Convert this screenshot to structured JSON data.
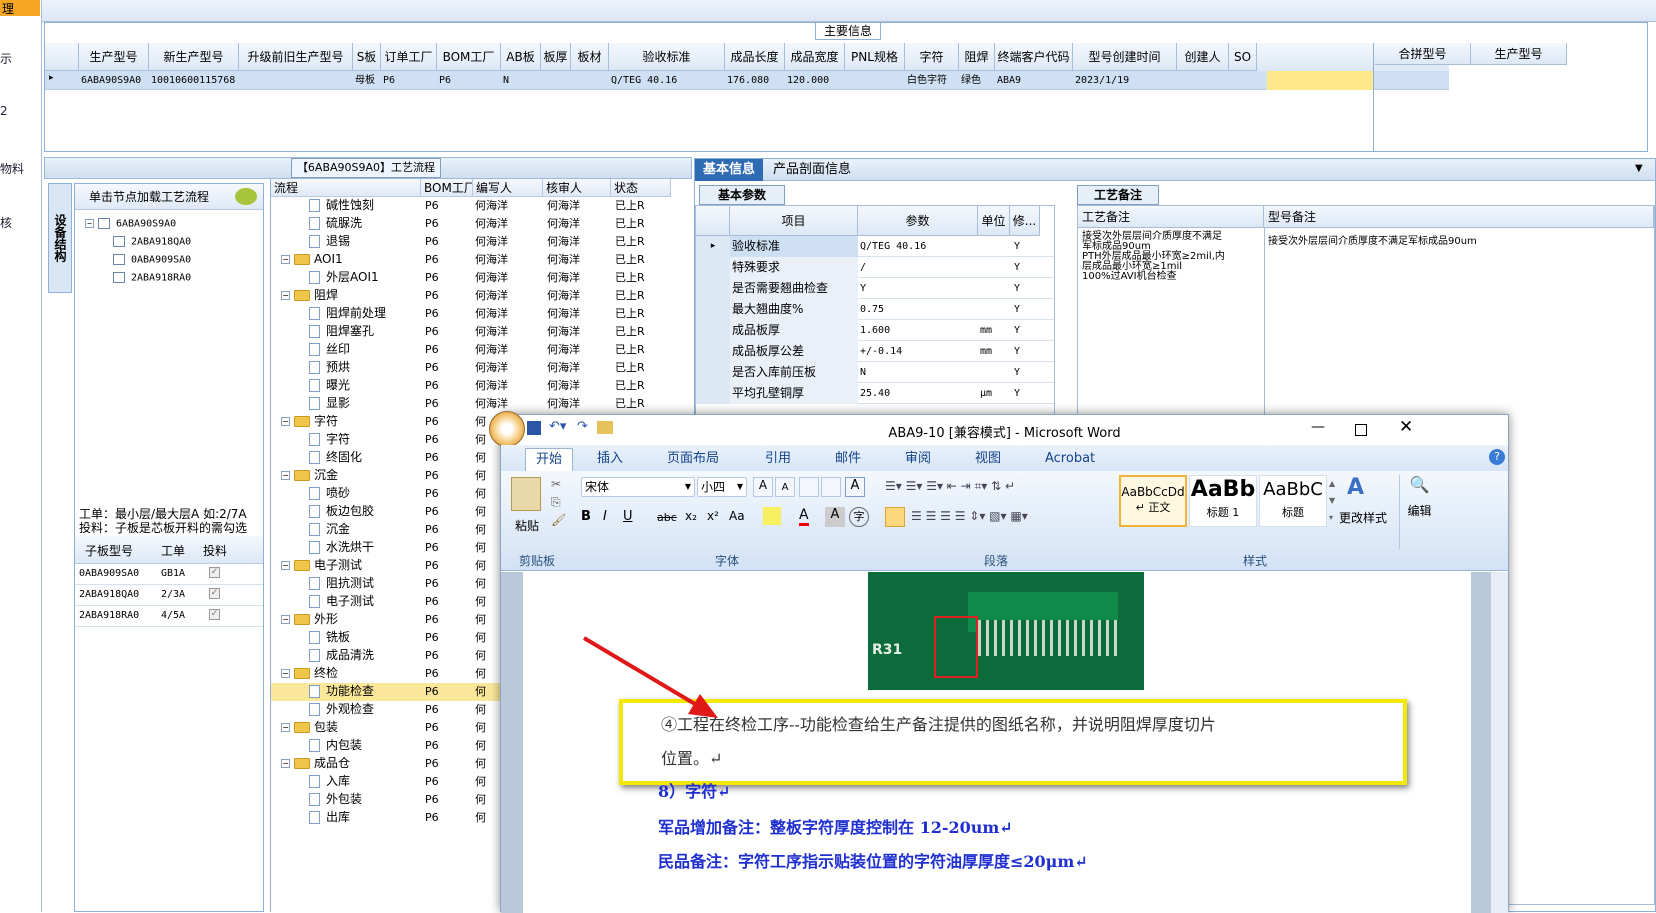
{
  "left_trim": {
    "labels": [
      "理",
      "示",
      "2",
      "物料",
      "核"
    ]
  },
  "main_info": {
    "legend": "主要信息",
    "headers": [
      "生产型号",
      "新生产型号",
      "升级前旧生产型号",
      "S板",
      "订单工厂",
      "BOM工厂",
      "AB板",
      "板厚",
      "板材",
      "验收标准",
      "成品长度",
      "成品宽度",
      "PNL规格",
      "字符",
      "阻焊",
      "终端客户代码",
      "型号创建时间",
      "创建人",
      "SO"
    ],
    "row": [
      "6ABA90S9A0",
      "10010600115768",
      "",
      "母板",
      "P6",
      "P6",
      "N",
      "",
      "",
      "Q/TEG 40.16",
      "176.080",
      "120.000",
      "",
      "白色字符",
      "绿色",
      "ABA9",
      "2023/1/19",
      "",
      ""
    ],
    "right_headers": [
      "合拼型号",
      "生产型号"
    ]
  },
  "flow": {
    "title": "【6ABA90S9A0】工艺流程",
    "lp_tab": "设备结构",
    "lp_header": "单击节点加载工艺流程",
    "tree": [
      "6ABA90S9A0",
      "2ABA918QA0",
      "0ABA909SA0",
      "2ABA918RA0"
    ],
    "note_lines": [
      "工单：最小层/最大层A 如:2/7A",
      "投料：子板是芯板开料的需勾选"
    ],
    "sub_headers": [
      "子板型号",
      "工单",
      "投料"
    ],
    "sub_rows": [
      [
        "0ABA909SA0",
        "GB1A"
      ],
      [
        "2ABA918QA0",
        "2/3A"
      ],
      [
        "2ABA918RA0",
        "4/5A"
      ]
    ],
    "headers": [
      "流程",
      "BOM工厂",
      "编写人",
      "核审人",
      "状态"
    ],
    "rows": [
      {
        "n": "碱性蚀刻",
        "t": "doc"
      },
      {
        "n": "硫脲洗",
        "t": "doc"
      },
      {
        "n": "退锡",
        "t": "doc"
      },
      {
        "n": "AOI1",
        "t": "folder"
      },
      {
        "n": "外层AOI1",
        "t": "doc"
      },
      {
        "n": "阻焊",
        "t": "folder"
      },
      {
        "n": "阻焊前处理",
        "t": "doc"
      },
      {
        "n": "阻焊塞孔",
        "t": "doc"
      },
      {
        "n": "丝印",
        "t": "doc"
      },
      {
        "n": "预烘",
        "t": "doc"
      },
      {
        "n": "曝光",
        "t": "doc"
      },
      {
        "n": "显影",
        "t": "doc"
      },
      {
        "n": "字符",
        "t": "folder"
      },
      {
        "n": "字符",
        "t": "doc"
      },
      {
        "n": "终固化",
        "t": "doc"
      },
      {
        "n": "沉金",
        "t": "folder"
      },
      {
        "n": "喷砂",
        "t": "doc"
      },
      {
        "n": "板边包胶",
        "t": "doc"
      },
      {
        "n": "沉金",
        "t": "doc"
      },
      {
        "n": "水洗烘干",
        "t": "doc"
      },
      {
        "n": "电子测试",
        "t": "folder"
      },
      {
        "n": "阻抗测试",
        "t": "doc"
      },
      {
        "n": "电子测试",
        "t": "doc"
      },
      {
        "n": "外形",
        "t": "folder"
      },
      {
        "n": "铣板",
        "t": "doc"
      },
      {
        "n": "成品清洗",
        "t": "doc"
      },
      {
        "n": "终检",
        "t": "folder"
      },
      {
        "n": "功能检查",
        "t": "doc"
      },
      {
        "n": "外观检查",
        "t": "doc"
      },
      {
        "n": "包装",
        "t": "folder"
      },
      {
        "n": "内包装",
        "t": "doc"
      },
      {
        "n": "成品仓",
        "t": "folder"
      },
      {
        "n": "入库",
        "t": "doc"
      },
      {
        "n": "外包装",
        "t": "doc"
      },
      {
        "n": "出库",
        "t": "doc"
      }
    ],
    "factory": "P6",
    "writer": "何海洋",
    "reviewer": "何海洋",
    "status": "已上R",
    "writer_short": "何"
  },
  "right": {
    "tabs": [
      "基本信息",
      "产品剖面信息"
    ],
    "sub_tab": "基本参数",
    "param_headers": [
      "项目",
      "参数",
      "单位",
      "修..."
    ],
    "params": [
      [
        "验收标准",
        "Q/TEG 40.16",
        "",
        "Y"
      ],
      [
        "特殊要求",
        "/",
        "",
        "Y"
      ],
      [
        "是否需要翘曲检查",
        "Y",
        "",
        "Y"
      ],
      [
        "最大翘曲度%",
        "0.75",
        "",
        "Y"
      ],
      [
        "成品板厚",
        "1.600",
        "mm",
        "Y"
      ],
      [
        "成品板厚公差",
        "+/-0.14",
        "mm",
        "Y"
      ],
      [
        "是否入库前压板",
        "N",
        "",
        "Y"
      ],
      [
        "平均孔壁铜厚",
        "25.40",
        "μm",
        "Y"
      ]
    ],
    "remark_tab": "工艺备注",
    "remark_headers": [
      "工艺备注",
      "型号备注"
    ],
    "remark_text": [
      "接受次外层层间介质厚度不满足",
      "军标成品90um",
      "PTH外层成品最小环宽≥2mil,内",
      "层成品最小环宽≥1mil",
      "100%过AVI机台检查"
    ],
    "model_remark": "接受次外层层间介质厚度不满足军标成品90um"
  },
  "word": {
    "title": "ABA9-10 [兼容模式] - Microsoft Word",
    "tabs": [
      "开始",
      "插入",
      "页面布局",
      "引用",
      "邮件",
      "审阅",
      "视图",
      "Acrobat"
    ],
    "font_name": "宋体",
    "font_size": "小四",
    "groups": [
      "剪贴板",
      "字体",
      "段落",
      "样式"
    ],
    "paste": "粘贴",
    "styles": [
      {
        "preview": "AaBbCcDd",
        "name": "↵ 正文"
      },
      {
        "preview": "AaBb",
        "name": "标题 1"
      },
      {
        "preview": "AaBbC",
        "name": "标题"
      }
    ],
    "change_styles": "更改样式",
    "edit": "编辑",
    "pcb_label": "R31",
    "box_text_1": "④工程在终检工序--功能检查给生产备注提供的图纸名称，并说明阻焊厚度切片",
    "box_text_2": "位置。↵",
    "line_8": "8）字符↵",
    "line_mil": "军品增加备注：整板字符厚度控制在 12-20um↵",
    "line_civ": "民品备注：字符工序指示贴装位置的字符油厚厚度≤20μm↵"
  }
}
